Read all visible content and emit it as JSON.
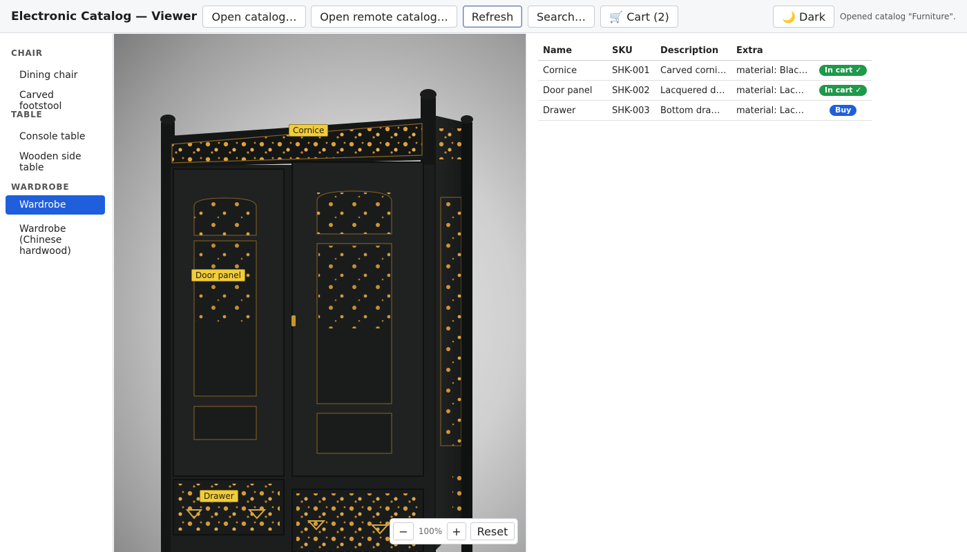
{
  "app": {
    "title": "Electronic Catalog — Viewer"
  },
  "toolbar": {
    "open_catalog": "Open catalog…",
    "open_remote": "Open remote catalog…",
    "refresh": "Refresh",
    "search": "Search…",
    "cart": "🛒 Cart (2)",
    "theme": "🌙 Dark",
    "status": "Opened catalog \"Furniture\"."
  },
  "sidebar": {
    "categories": [
      {
        "name": "CHAIR",
        "items": [
          "Dining chair",
          "Carved footstool"
        ]
      },
      {
        "name": "TABLE",
        "items": [
          "Console table",
          "Wooden side table"
        ]
      },
      {
        "name": "WARDROBE",
        "items": [
          "Wardrobe",
          "Wardrobe (Chinese hardwood)"
        ]
      }
    ],
    "selected": "Wardrobe"
  },
  "viewer": {
    "hotspots": [
      "Cornice",
      "Door panel",
      "Drawer"
    ],
    "zoom": {
      "minus": "−",
      "level": "100%",
      "plus": "+",
      "reset": "Reset"
    }
  },
  "table": {
    "headers": [
      "Name",
      "SKU",
      "Description",
      "Extra"
    ],
    "rows": [
      {
        "name": "Cornice",
        "sku": "SHK-001",
        "description": "Carved cornice",
        "extra": "material: Black lacquer",
        "action": "In cart ✓"
      },
      {
        "name": "Door panel",
        "sku": "SHK-002",
        "description": "Lacquered door",
        "extra": "material: Lacquer",
        "action": "In cart ✓"
      },
      {
        "name": "Drawer",
        "sku": "SHK-003",
        "description": "Bottom drawer",
        "extra": "material: Lacquer",
        "action": "Buy"
      }
    ]
  },
  "colors": {
    "accent": "#1f5fdb",
    "in_cart": "#1e9a4a",
    "hotspot": "#f0cd3c",
    "cabinet": "#1c1e1d",
    "inlay": "#e0a23a"
  }
}
